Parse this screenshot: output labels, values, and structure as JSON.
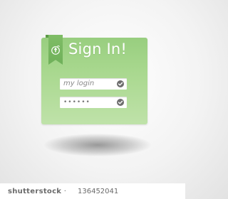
{
  "form": {
    "title": "Sign In!",
    "login_value": "my login",
    "password_value": "••••••"
  },
  "icons": {
    "ribbon_lock": "lock-icon",
    "login_status": "check-icon",
    "password_status": "check-icon"
  },
  "watermark": {
    "brand_prefix": "shutterstock",
    "brand_suffix": " · ",
    "id_text": "136452041"
  },
  "colors": {
    "panel_green": "#a9d88f",
    "ribbon_green": "#7fbd66",
    "field_bg": "#ffffff",
    "check_gray": "#6e6e6e"
  }
}
